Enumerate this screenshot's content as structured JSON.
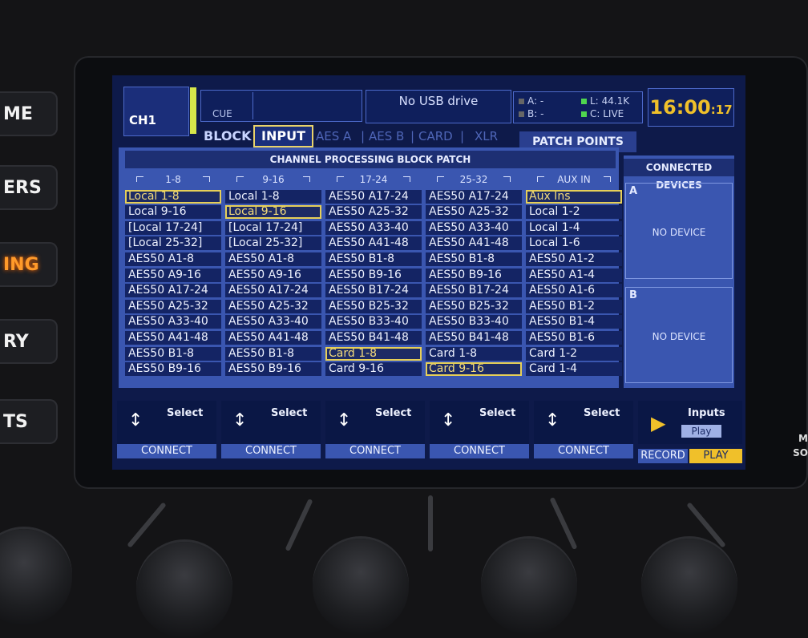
{
  "side_keys": [
    "ME",
    "ERS",
    "ING",
    "RY",
    "TS"
  ],
  "right_edge": {
    "m": "M",
    "so": "SO"
  },
  "header": {
    "channel": "CH1",
    "cue_label": "CUE",
    "usb_status": "No USB drive",
    "ab": {
      "a_label": "A:",
      "a_value": "-",
      "b_label": "B:",
      "b_value": "-",
      "l_label": "L:",
      "l_value": "44.1K",
      "c_label": "C:",
      "c_value": "LIVE"
    },
    "clock_main": "16:00",
    "clock_sec": ":17"
  },
  "tabs": {
    "block": "BLOCK",
    "input": "INPUT",
    "aes_a": "AES A",
    "aes_b": "AES B",
    "card": "CARD",
    "xlr": "XLR",
    "patch_points": "PATCH POINTS"
  },
  "panel": {
    "title": "CHANNEL PROCESSING BLOCK PATCH",
    "columns": [
      {
        "header": "1-8",
        "items": [
          "Local 1-8",
          "Local 9-16",
          "[Local 17-24]",
          "[Local 25-32]",
          "AES50 A1-8",
          "AES50 A9-16",
          "AES50 A17-24",
          "AES50 A25-32",
          "AES50 A33-40",
          "AES50 A41-48",
          "AES50 B1-8",
          "AES50 B9-16"
        ],
        "selected": 0
      },
      {
        "header": "9-16",
        "items": [
          "Local 1-8",
          "Local 9-16",
          "[Local 17-24]",
          "[Local 25-32]",
          "AES50 A1-8",
          "AES50 A9-16",
          "AES50 A17-24",
          "AES50 A25-32",
          "AES50 A33-40",
          "AES50 A41-48",
          "AES50 B1-8",
          "AES50 B9-16"
        ],
        "selected": 1
      },
      {
        "header": "17-24",
        "items": [
          "AES50 A17-24",
          "AES50 A25-32",
          "AES50 A33-40",
          "AES50 A41-48",
          "AES50 B1-8",
          "AES50 B9-16",
          "AES50 B17-24",
          "AES50 B25-32",
          "AES50 B33-40",
          "AES50 B41-48",
          "Card 1-8",
          "Card 9-16"
        ],
        "selected": 10
      },
      {
        "header": "25-32",
        "items": [
          "AES50 A17-24",
          "AES50 A25-32",
          "AES50 A33-40",
          "AES50 A41-48",
          "AES50 B1-8",
          "AES50 B9-16",
          "AES50 B17-24",
          "AES50 B25-32",
          "AES50 B33-40",
          "AES50 B41-48",
          "Card 1-8",
          "Card 9-16"
        ],
        "selected": 11
      },
      {
        "header": "AUX IN",
        "items": [
          "Aux Ins",
          "Local 1-2",
          "Local 1-4",
          "Local 1-6",
          "AES50 A1-2",
          "AES50 A1-4",
          "AES50 A1-6",
          "AES50 B1-2",
          "AES50 B1-4",
          "AES50 B1-6",
          "Card 1-2",
          "Card 1-4"
        ],
        "selected": 0
      }
    ]
  },
  "devices": {
    "title": "CONNECTED DEVICES",
    "a_letter": "A",
    "a_status": "NO DEVICE",
    "b_letter": "B",
    "b_status": "NO DEVICE"
  },
  "encoders": [
    {
      "label": "Select",
      "button": "CONNECT"
    },
    {
      "label": "Select",
      "button": "CONNECT"
    },
    {
      "label": "Select",
      "button": "CONNECT"
    },
    {
      "label": "Select",
      "button": "CONNECT"
    },
    {
      "label": "Select",
      "button": "CONNECT"
    }
  ],
  "player": {
    "label": "Inputs",
    "play_button": "Play",
    "record": "RECORD",
    "play": "PLAY"
  },
  "colors": {
    "screen_bg": "#0e1a4a",
    "panel": "#3a56b0",
    "cell": "#142464",
    "accent": "#f0c02a",
    "selected_outline": "#e6cf58"
  }
}
